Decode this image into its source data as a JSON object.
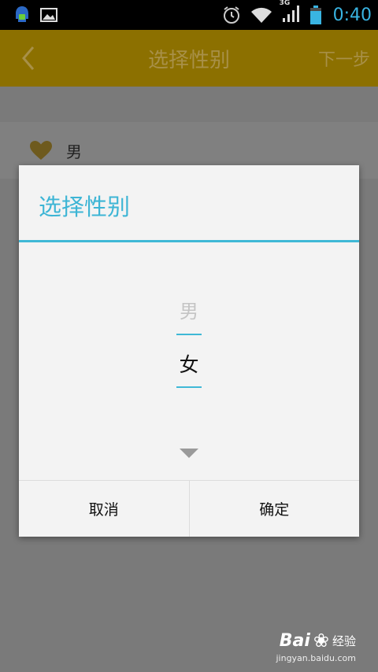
{
  "status_bar": {
    "time": "0:40",
    "network": "3G",
    "icons": [
      "notification-app-icon",
      "image-icon",
      "alarm-icon",
      "wifi-icon",
      "signal-icon",
      "battery-icon"
    ],
    "time_color": "#39b4e2"
  },
  "app_bar": {
    "title": "选择性别",
    "next_label": "下一步",
    "back_icon": "chevron-left-icon",
    "color": "#8c7000"
  },
  "gender_row": {
    "icon": "heart-icon",
    "value": "男"
  },
  "dialog": {
    "title": "选择性别",
    "accent_color": "#3fb8d6",
    "picker": {
      "options": [
        "男",
        "女"
      ],
      "previous_option": "男",
      "selected": "女",
      "indicator_icon": "triangle-down-icon"
    },
    "cancel_label": "取消",
    "confirm_label": "确定"
  },
  "watermark": {
    "brand": "Bai",
    "product": "经验",
    "url": "jingyan.baidu.com"
  }
}
